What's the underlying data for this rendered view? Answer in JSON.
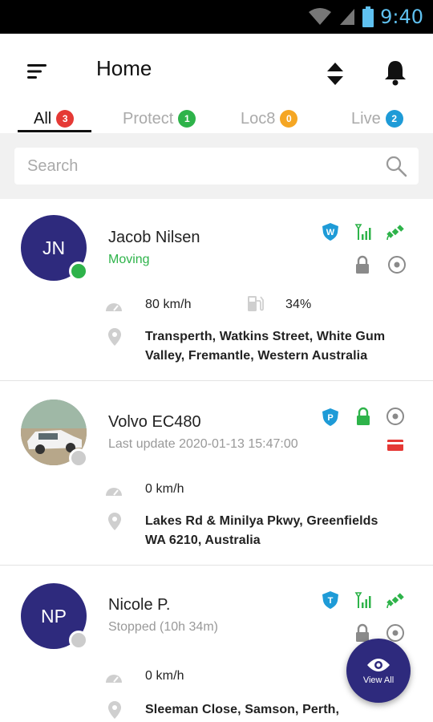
{
  "status_bar": {
    "time": "9:40",
    "time_color": "#5fc1f0"
  },
  "header": {
    "title": "Home",
    "icons": [
      "menu-icon",
      "sort-icon",
      "bell-icon"
    ]
  },
  "tabs": [
    {
      "label": "All",
      "count": "3",
      "badge_color": "#e53935",
      "active": true
    },
    {
      "label": "Protect",
      "count": "1",
      "badge_color": "#2eb34a",
      "active": false
    },
    {
      "label": "Loc8",
      "count": "0",
      "badge_color": "#f5a623",
      "active": false
    },
    {
      "label": "Live",
      "count": "2",
      "badge_color": "#1e9bd7",
      "active": false
    }
  ],
  "search": {
    "placeholder": "Search"
  },
  "vehicles": [
    {
      "initials": "JN",
      "name": "Jacob Nilsen",
      "status": "Moving",
      "status_color": "#2eb34a",
      "online_dot_color": "#2eb34a",
      "plan_badge": "W",
      "speed": "80 km/h",
      "fuel": "34%",
      "address_line1": "Transperth, Watkins Street, White Gum",
      "address_line2": "Valley, Fremantle, Western Australia"
    },
    {
      "name": "Volvo EC480",
      "status": "Last update 2020-01-13 15:47:00",
      "status_color": "#999999",
      "online_dot_color": "#cccccc",
      "plan_badge": "P",
      "speed": "0 km/h",
      "address_line1": "Lakes Rd & Minilya Pkwy, Greenfields",
      "address_line2": "WA 6210, Australia"
    },
    {
      "initials": "NP",
      "name": "Nicole P.",
      "status": "Stopped (10h 34m)",
      "status_color": "#999999",
      "online_dot_color": "#cccccc",
      "plan_badge": "T",
      "speed": "0 km/h",
      "address_line1": "Sleeman Close, Samson, Perth,"
    }
  ],
  "fab": {
    "label": "View All"
  },
  "colors": {
    "brand": "#2e2a7d",
    "accent_blue": "#1e9bd7",
    "green": "#2eb34a",
    "red": "#e53935"
  }
}
